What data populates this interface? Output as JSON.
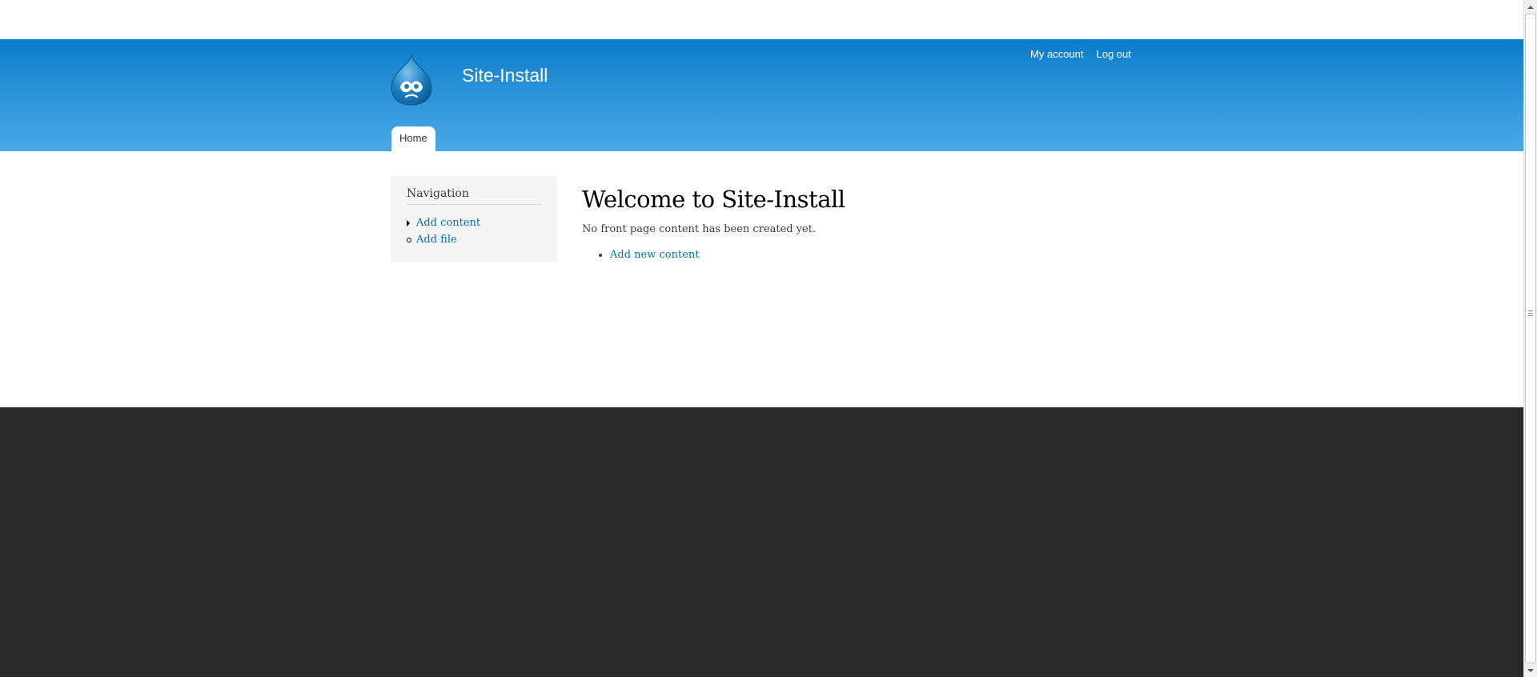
{
  "header": {
    "site_name": "Site-Install",
    "logo_icon": "drupal-drop-logo",
    "secondary_menu": [
      {
        "label": "My account"
      },
      {
        "label": "Log out"
      }
    ],
    "main_menu": [
      {
        "label": "Home",
        "active": true
      }
    ]
  },
  "sidebar": {
    "title": "Navigation",
    "items": [
      {
        "label": "Add content",
        "marker": "collapsed"
      },
      {
        "label": "Add file",
        "marker": "leaf"
      }
    ]
  },
  "main": {
    "title": "Welcome to Site-Install",
    "message": "No front page content has been created yet.",
    "links": [
      {
        "label": "Add new content"
      }
    ]
  },
  "colors": {
    "header_top": "#0a7bc9",
    "header_bottom": "#4aa8e6",
    "link": "#0071b3",
    "footer": "#292929",
    "sidebar_bg": "#f5f5f5"
  }
}
